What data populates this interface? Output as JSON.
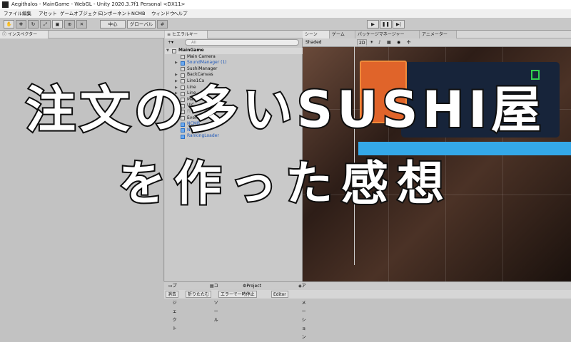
{
  "window": {
    "title": "Aegithalos - MainGame - WebGL - Unity 2020.3.7f1 Personal <DX11>"
  },
  "menu": [
    "ファイル",
    "編集",
    "アセット",
    "ゲームオブジェクト",
    "コンポーネント",
    "NCMB",
    "ウィンドウ",
    "ヘルプ"
  ],
  "toolbar": {
    "pivot_label": "中心",
    "global_label": "グローバル"
  },
  "inspector": {
    "tab_label": "インスペクター"
  },
  "hierarchy": {
    "tab_label": "ヒエラルキー",
    "add_label": "+▾",
    "search_placeholder": "All",
    "items": [
      {
        "label": "MainGame",
        "style": "scene",
        "indent": 0,
        "arrow": "▼"
      },
      {
        "label": "Main Camera",
        "style": "normal",
        "indent": 1,
        "arrow": ""
      },
      {
        "label": "SoundManager (1)",
        "style": "blue",
        "indent": 1,
        "arrow": "▶"
      },
      {
        "label": "SushiManager",
        "style": "normal",
        "indent": 1,
        "arrow": ""
      },
      {
        "label": "BackCanvas",
        "style": "normal",
        "indent": 1,
        "arrow": "▶"
      },
      {
        "label": "Line1Ca",
        "style": "normal",
        "indent": 1,
        "arrow": "▶"
      },
      {
        "label": "Line",
        "style": "normal",
        "indent": 1,
        "arrow": "▶"
      },
      {
        "label": "Line",
        "style": "normal",
        "indent": 1,
        "arrow": "▶"
      },
      {
        "label": "MainU",
        "style": "normal",
        "indent": 1,
        "arrow": "▶"
      },
      {
        "label": "UIC",
        "style": "normal",
        "indent": 1,
        "arrow": "▶"
      },
      {
        "label": "Fin",
        "style": "grey",
        "indent": 1,
        "arrow": ""
      },
      {
        "label": "EventSy",
        "style": "normal",
        "indent": 1,
        "arrow": ""
      },
      {
        "label": "NCMB",
        "style": "blue",
        "indent": 1,
        "arrow": ""
      },
      {
        "label": "NCMB",
        "style": "blue",
        "indent": 1,
        "arrow": ""
      },
      {
        "label": "RankingLoader",
        "style": "blue",
        "indent": 1,
        "arrow": ""
      }
    ]
  },
  "scene": {
    "tabs": [
      "シーン",
      "ゲーム",
      "パッケージマネージャー",
      "アニメーター"
    ],
    "shading_mode": "Shaded",
    "mode_2d": "2D"
  },
  "bottom": {
    "tabs": [
      "プロジェクト",
      "コンソール",
      "Project Settings",
      "アニメーション"
    ],
    "console_buttons": [
      "消去",
      "折りたたむ",
      "エラーで一時停止",
      "Editor"
    ]
  },
  "overlay": {
    "line1": "注文の多いSUSHI屋",
    "line2": "を作った感想"
  }
}
